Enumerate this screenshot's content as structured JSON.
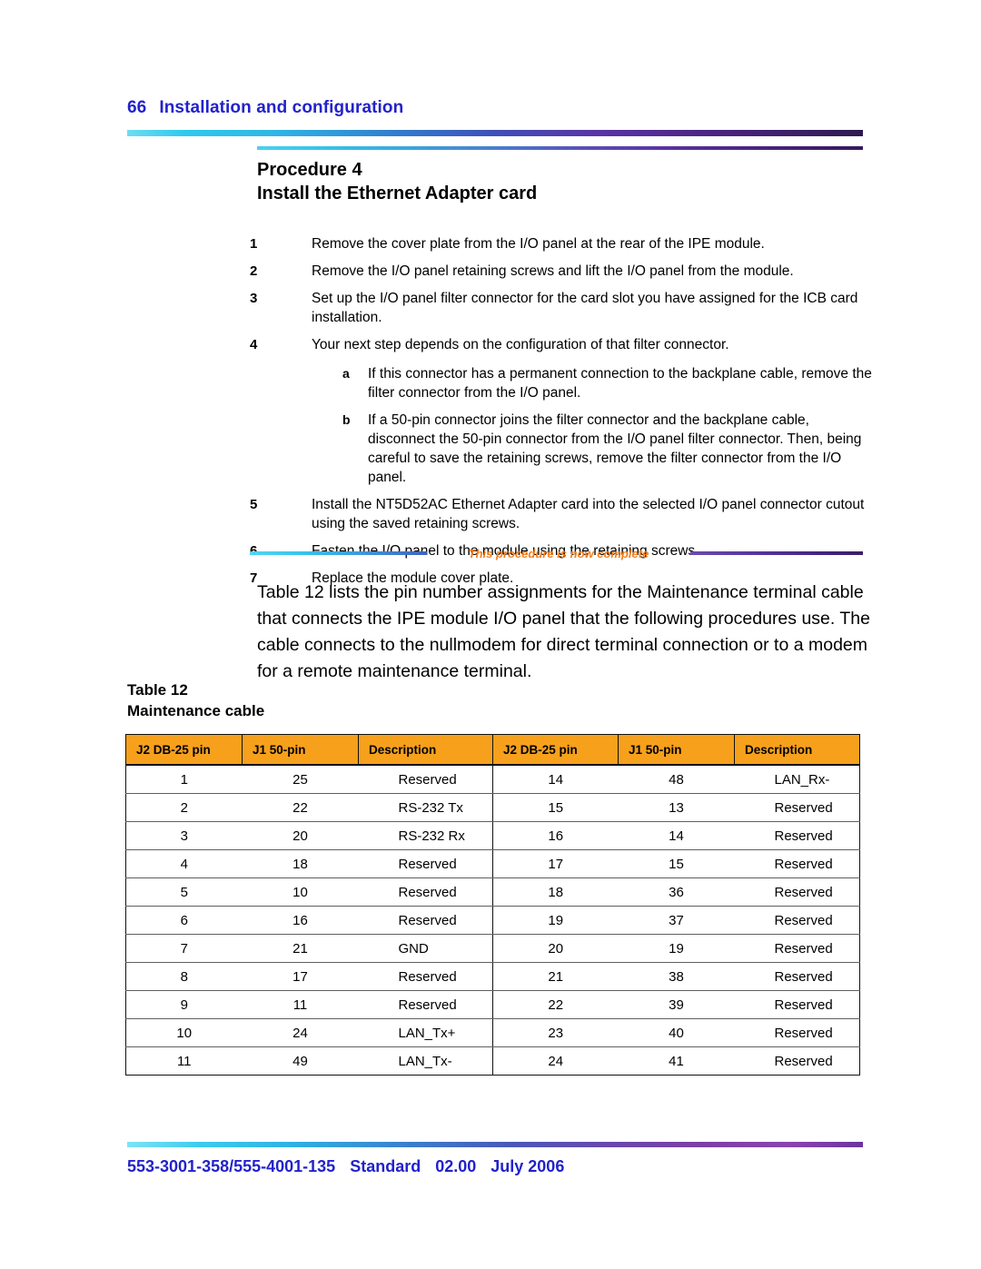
{
  "header": {
    "page_number": "66",
    "title": "Installation and configuration"
  },
  "procedure": {
    "label": "Procedure 4",
    "title": "Install the Ethernet Adapter card",
    "complete_note": "This procedure is now complete",
    "steps": [
      {
        "marker": "1",
        "text": "Remove the cover plate from the I/O panel at the rear of the IPE module."
      },
      {
        "marker": "2",
        "text": "Remove the I/O panel retaining screws and lift the I/O panel from the module."
      },
      {
        "marker": "3",
        "text": "Set up the I/O panel filter connector for the card slot you have assigned for the ICB card installation."
      },
      {
        "marker": "4",
        "text": "Your next step depends on the configuration of that filter connector.",
        "substeps": [
          {
            "marker": "a",
            "text": "If this connector has a permanent connection to the backplane cable, remove the filter connector from the I/O panel."
          },
          {
            "marker": "b",
            "text": "If a 50-pin connector joins the filter connector and the backplane cable, disconnect the 50-pin connector from the I/O panel filter connector. Then, being careful to save the retaining screws, remove the filter connector from the I/O panel."
          }
        ]
      },
      {
        "marker": "5",
        "text": "Install the NT5D52AC Ethernet Adapter card into the selected I/O panel connector cutout using the saved retaining screws."
      },
      {
        "marker": "6",
        "text": "Fasten the I/O panel to the module using the retaining screws."
      },
      {
        "marker": "7",
        "text": "Replace the module cover plate."
      }
    ]
  },
  "intro_paragraph": "Table 12 lists the pin number assignments for the Maintenance terminal cable that connects the IPE module I/O panel that the following procedures use. The cable connects to the nullmodem for direct terminal connection or to a modem for a remote maintenance terminal.",
  "table": {
    "caption_label": "Table 12",
    "caption_title": "Maintenance cable",
    "headers": [
      "J2 DB-25 pin",
      "J1 50-pin",
      "Description",
      "J2 DB-25 pin",
      "J1 50-pin",
      "Description"
    ],
    "rows": [
      [
        "1",
        "25",
        "Reserved",
        "14",
        "48",
        "LAN_Rx-"
      ],
      [
        "2",
        "22",
        "RS-232 Tx",
        "15",
        "13",
        "Reserved"
      ],
      [
        "3",
        "20",
        "RS-232 Rx",
        "16",
        "14",
        "Reserved"
      ],
      [
        "4",
        "18",
        "Reserved",
        "17",
        "15",
        "Reserved"
      ],
      [
        "5",
        "10",
        "Reserved",
        "18",
        "36",
        "Reserved"
      ],
      [
        "6",
        "16",
        "Reserved",
        "19",
        "37",
        "Reserved"
      ],
      [
        "7",
        "21",
        "GND",
        "20",
        "19",
        "Reserved"
      ],
      [
        "8",
        "17",
        "Reserved",
        "21",
        "38",
        "Reserved"
      ],
      [
        "9",
        "11",
        "Reserved",
        "22",
        "39",
        "Reserved"
      ],
      [
        "10",
        "24",
        "LAN_Tx+",
        "23",
        "40",
        "Reserved"
      ],
      [
        "11",
        "49",
        "LAN_Tx-",
        "24",
        "41",
        "Reserved"
      ]
    ]
  },
  "footer": {
    "doc_numbers": "553-3001-358/555-4001-135",
    "status": "Standard",
    "version": "02.00",
    "date": "July 2006"
  },
  "colors": {
    "accent_blue": "#2222cc",
    "table_header_orange": "#f6a01c",
    "complete_orange": "#f4801e"
  }
}
